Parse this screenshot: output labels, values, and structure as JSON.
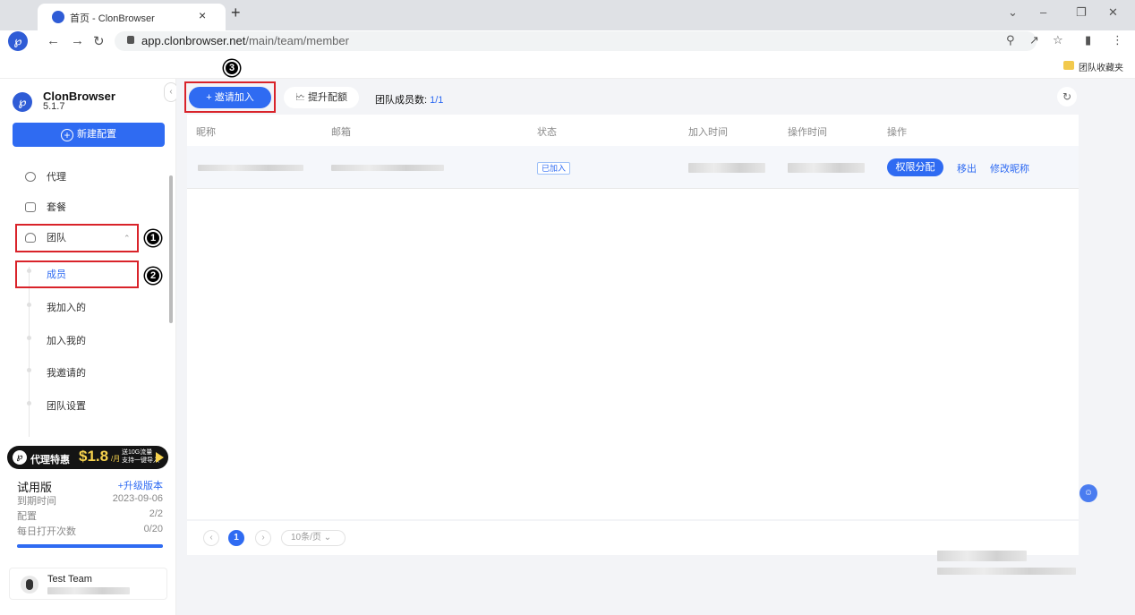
{
  "browser": {
    "tab_title": "首页 - ClonBrowser",
    "close_glyph": "×",
    "newtab_glyph": "+",
    "url_host": "app.clonbrowser.net",
    "url_path": "/main/team/member",
    "bookmark_label": "团队收藏夹"
  },
  "sidebar": {
    "brand_name": "ClonBrowser",
    "version": "5.1.7",
    "new_config_label": "新建配置",
    "menu": [
      {
        "label": "代理",
        "icon": "globe-icon"
      },
      {
        "label": "套餐",
        "icon": "wallet-icon"
      },
      {
        "label": "团队",
        "icon": "team-icon"
      }
    ],
    "submenu": [
      {
        "label": "成员",
        "active": true
      },
      {
        "label": "我加入的"
      },
      {
        "label": "加入我的"
      },
      {
        "label": "我邀请的"
      },
      {
        "label": "团队设置"
      }
    ],
    "promo": {
      "text": "代理特惠",
      "price": "$1.8",
      "unit": "/月",
      "note": "送10G流量 支持一键导入"
    },
    "plan": {
      "name": "试用版",
      "upgrade_label": "+升级版本",
      "expire_label": "到期时间",
      "expire_value": "2023-09-06",
      "config_label": "配置",
      "config_value": "2/2",
      "opens_label": "每日打开次数",
      "opens_value": "0/20",
      "opens_progress": 1.0
    },
    "team_name": "Test Team"
  },
  "main": {
    "invite_label": "邀请加入",
    "boost_label": "提升配额",
    "member_count_label": "团队成员数:",
    "member_count_value": "1/1",
    "columns": [
      "昵称",
      "邮箱",
      "状态",
      "加入时间",
      "操作时间",
      "操作"
    ],
    "rows": [
      {
        "status": "已加入",
        "actions": [
          "权限分配",
          "移出",
          "修改昵称"
        ]
      }
    ],
    "pagination": {
      "current": "1",
      "page_size": "10条/页"
    }
  },
  "annotations": [
    "1",
    "2",
    "3"
  ],
  "colors": {
    "accent": "#2f6bf2",
    "callout": "#d9232a"
  }
}
